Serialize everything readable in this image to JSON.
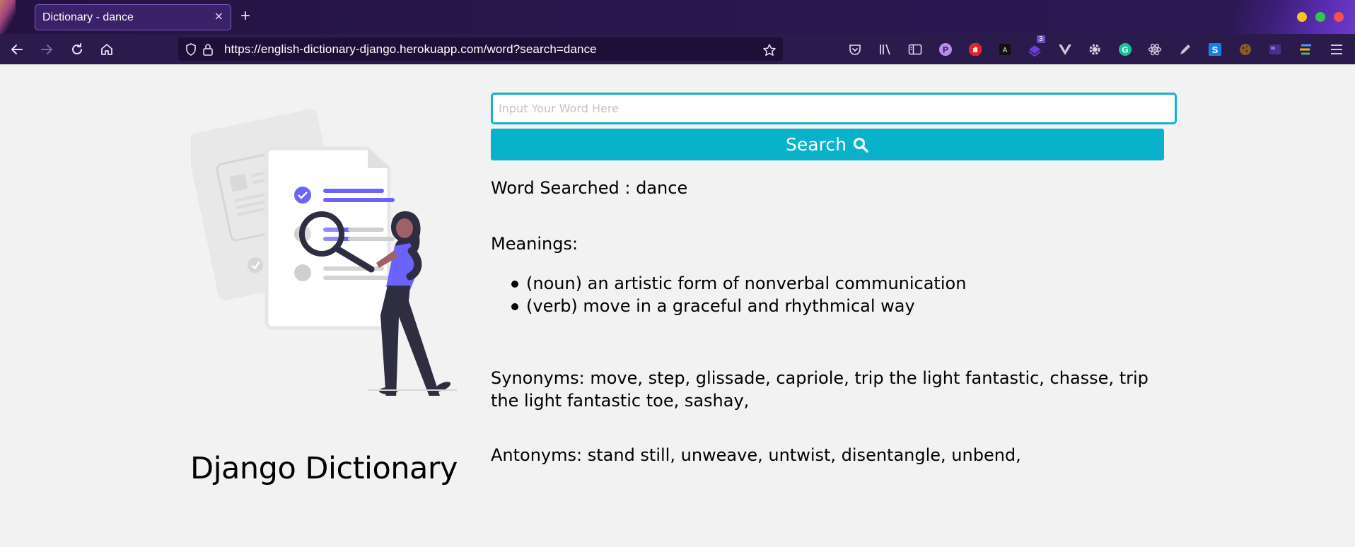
{
  "browser": {
    "tab_title": "Dictionary - dance",
    "tab_close": "×",
    "new_tab": "+",
    "url": "https://english-dictionary-django.herokuapp.com/word?search=dance",
    "extension_badge": "3",
    "extensions": [
      "pocket-icon",
      "library-icon",
      "sidebar-icon",
      "p-extension-icon",
      "stop-extension-icon",
      "dark-reader-icon",
      "badge-extension-icon",
      "vue-devtools-icon",
      "gear-extension-icon",
      "grammarly-icon",
      "react-devtools-icon",
      "pen-icon",
      "s-extension-icon",
      "cookie-icon",
      "window-extension-icon",
      "stripes-extension-icon",
      "menu-icon"
    ],
    "window_dot_colors": [
      "#f5c02a",
      "#34c64a",
      "#f5504a"
    ]
  },
  "page": {
    "search_placeholder": "Input Your Word Here",
    "search_button": "Search",
    "word_searched": "Word Searched : dance",
    "meanings_label": "Meanings:",
    "meanings": [
      "(noun) an artistic form of nonverbal communication",
      "(verb) move in a graceful and rhythmical way"
    ],
    "synonyms": "Synonyms: move, step, glissade, capriole, trip the light fantastic, chasse, trip the light fantastic toe, sashay,",
    "antonyms": "Antonyms: stand still, unweave, untwist, disentangle, unbend,",
    "site_title": "Django Dictionary"
  },
  "colors": {
    "accent": "#08b2cb",
    "illustration_purple": "#6c63ff",
    "chrome_dark": "#241341"
  }
}
